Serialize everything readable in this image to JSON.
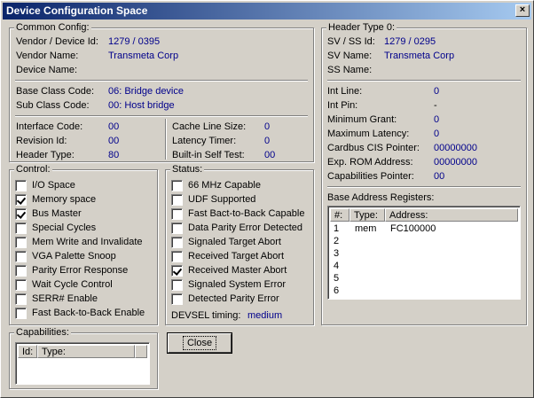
{
  "window": {
    "title": "Device Configuration Space",
    "close_glyph": "×"
  },
  "common": {
    "title": "Common Config:",
    "vendor_device_label": "Vendor / Device Id:",
    "vendor_device": "1279 / 0395",
    "vendor_name_label": "Vendor Name:",
    "vendor_name": "Transmeta Corp",
    "device_name_label": "Device Name:",
    "device_name": "",
    "base_class_label": "Base Class Code:",
    "base_class": "06: Bridge device",
    "sub_class_label": "Sub Class Code:",
    "sub_class": "00: Host bridge",
    "interface_label": "Interface Code:",
    "interface": "00",
    "revision_label": "Revision Id:",
    "revision": "00",
    "header_type_label": "Header Type:",
    "header_type": "80",
    "cache_line_label": "Cache Line Size:",
    "cache_line": "0",
    "latency_label": "Latency Timer:",
    "latency": "0",
    "bist_label": "Built-in Self Test:",
    "bist": "00"
  },
  "control": {
    "title": "Control:",
    "items": [
      {
        "label": "I/O Space",
        "checked": false
      },
      {
        "label": "Memory space",
        "checked": true
      },
      {
        "label": "Bus Master",
        "checked": true
      },
      {
        "label": "Special Cycles",
        "checked": false
      },
      {
        "label": "Mem Write and Invalidate",
        "checked": false
      },
      {
        "label": "VGA Palette Snoop",
        "checked": false
      },
      {
        "label": "Parity Error Response",
        "checked": false
      },
      {
        "label": "Wait Cycle Control",
        "checked": false
      },
      {
        "label": "SERR# Enable",
        "checked": false
      },
      {
        "label": "Fast Back-to-Back Enable",
        "checked": false
      }
    ]
  },
  "status": {
    "title": "Status:",
    "items": [
      {
        "label": "66 MHz Capable",
        "checked": false
      },
      {
        "label": "UDF Supported",
        "checked": false
      },
      {
        "label": "Fast Bact-to-Back Capable",
        "checked": false
      },
      {
        "label": "Data Parity Error Detected",
        "checked": false
      },
      {
        "label": "Signaled Target Abort",
        "checked": false
      },
      {
        "label": "Received Target Abort",
        "checked": false
      },
      {
        "label": "Received Master Abort",
        "checked": true
      },
      {
        "label": "Signaled System Error",
        "checked": false
      },
      {
        "label": "Detected Parity Error",
        "checked": false
      }
    ],
    "devsel_label": "DEVSEL timing:",
    "devsel": "medium"
  },
  "header0": {
    "title": "Header Type 0:",
    "sv_ss_label": "SV / SS Id:",
    "sv_ss": "1279 / 0295",
    "sv_name_label": "SV Name:",
    "sv_name": "Transmeta Corp",
    "ss_name_label": "SS Name:",
    "ss_name": "",
    "int_line_label": "Int Line:",
    "int_line": "0",
    "int_pin_label": "Int Pin:",
    "int_pin": "-",
    "min_grant_label": "Minimum Grant:",
    "min_grant": "0",
    "max_latency_label": "Maximum Latency:",
    "max_latency": "0",
    "cardbus_label": "Cardbus CIS Pointer:",
    "cardbus": "00000000",
    "exp_rom_label": "Exp. ROM Address:",
    "exp_rom": "00000000",
    "cap_ptr_label": "Capabilities Pointer:",
    "cap_ptr": "00",
    "bar_title": "Base Address Registers:",
    "bar_columns": [
      "#:",
      "Type:",
      "Address:"
    ],
    "bar_rows": [
      {
        "num": "1",
        "type": "mem",
        "address": "FC100000"
      },
      {
        "num": "2",
        "type": "",
        "address": ""
      },
      {
        "num": "3",
        "type": "",
        "address": ""
      },
      {
        "num": "4",
        "type": "",
        "address": ""
      },
      {
        "num": "5",
        "type": "",
        "address": ""
      },
      {
        "num": "6",
        "type": "",
        "address": ""
      }
    ]
  },
  "capabilities": {
    "title": "Capabilities:",
    "columns": [
      "Id:",
      "Type:"
    ]
  },
  "close_button": "Close"
}
